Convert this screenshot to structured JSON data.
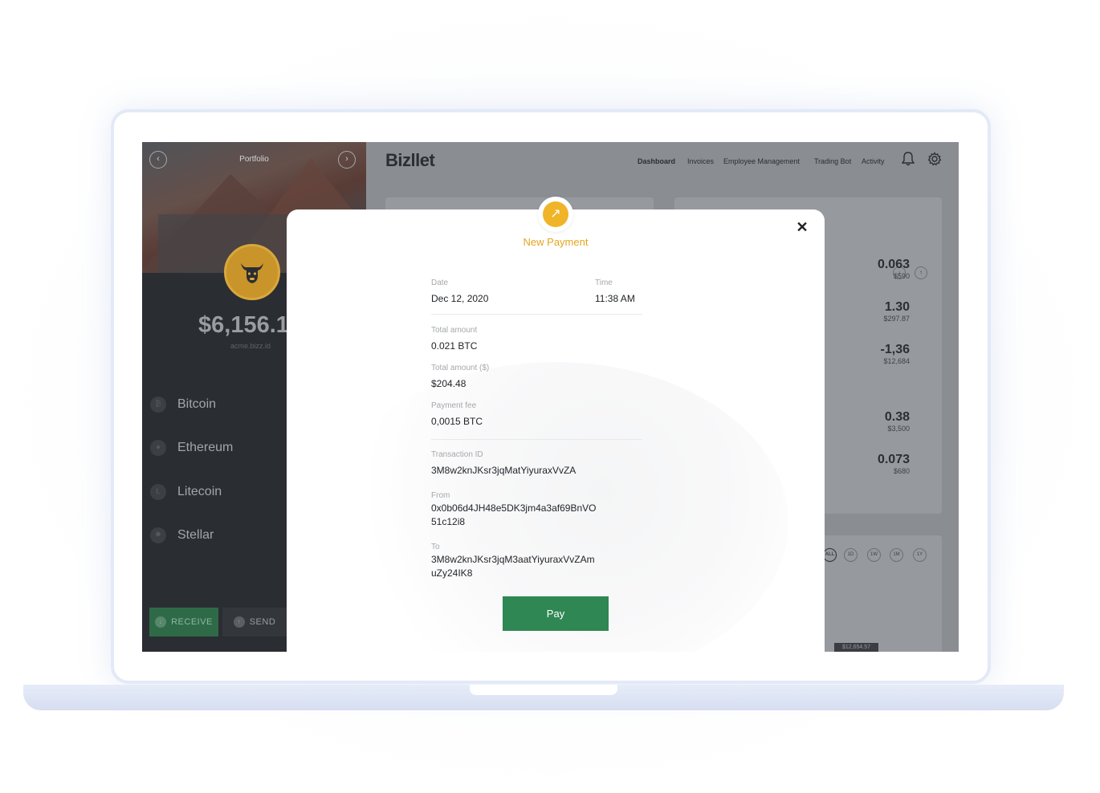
{
  "sidebar": {
    "title": "Portfolio",
    "prev_icon": "chevron-left-icon",
    "next_icon": "chevron-right-icon",
    "balance": "$6,156.1",
    "account": "acme.bizz.id",
    "coins": [
      {
        "label": "Bitcoin",
        "icon": "bitcoin-icon"
      },
      {
        "label": "Ethereum",
        "icon": "ethereum-icon"
      },
      {
        "label": "Litecoin",
        "icon": "litecoin-icon"
      },
      {
        "label": "Stellar",
        "icon": "stellar-icon"
      }
    ],
    "receive_label": "RECEIVE",
    "send_label": "SEND"
  },
  "topbar": {
    "logo": "Bizllet",
    "menu": [
      "Dashboard",
      "Invoices",
      "Employee Management",
      "Trading Bot",
      "Activity"
    ],
    "active_menu": "Dashboard",
    "icons": [
      "bell-icon",
      "gear-icon"
    ]
  },
  "holdings": [
    {
      "amount": "0.063",
      "usd": "$590"
    },
    {
      "amount": "1.30",
      "usd": "$297.87"
    },
    {
      "amount": "-1,36",
      "usd": "$12,684"
    },
    {
      "amount": "0.38",
      "usd": "$3,500"
    },
    {
      "amount": "0.073",
      "usd": "$680"
    }
  ],
  "ranges": [
    "ALL",
    "1D",
    "1W",
    "1M",
    "1Y"
  ],
  "chart_tooltip": "$12,654.57",
  "modal": {
    "title": "New Payment",
    "date_label": "Date",
    "date_value": "Dec 12, 2020",
    "time_label": "Time",
    "time_value": "11:38 AM",
    "total_label": "Total amount",
    "total_value": "0.021 BTC",
    "total_usd_label": "Total amount ($)",
    "total_usd_value": "$204.48",
    "fee_label": "Payment fee",
    "fee_value": "0,0015 BTC",
    "txid_label": "Transaction ID",
    "txid_value": "3M8w2knJKsr3jqMatYiyuraxVvZA",
    "from_label": "From",
    "from_line1": "0x0b06d4JH48e5DK3jm4a3af69BnVO",
    "from_line2": "51c12i8",
    "to_label": "To",
    "to_line1": "3M8w2knJKsr3jqM3aatYiyuraxVvZAm",
    "to_line2": "uZy24IK8",
    "pay_label": "Pay"
  },
  "colors": {
    "accent": "#f0b429",
    "pay_button": "#2f8754",
    "sidebar_bg": "#2a2d31"
  }
}
